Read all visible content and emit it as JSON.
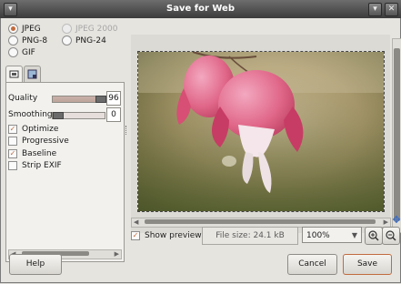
{
  "window": {
    "title": "Save for Web"
  },
  "format": {
    "options": [
      {
        "label": "JPEG",
        "selected": true,
        "disabled": false
      },
      {
        "label": "JPEG 2000",
        "selected": false,
        "disabled": true
      },
      {
        "label": "PNG-8",
        "selected": false,
        "disabled": false
      },
      {
        "label": "PNG-24",
        "selected": false,
        "disabled": false
      },
      {
        "label": "GIF",
        "selected": false,
        "disabled": false
      }
    ]
  },
  "settings": {
    "quality_label": "Quality",
    "quality_value": "96",
    "quality_level": 0.96,
    "smoothing_label": "Smoothing",
    "smoothing_value": "0",
    "smoothing_level": 0.0,
    "checks": [
      {
        "label": "Optimize",
        "checked": true
      },
      {
        "label": "Progressive",
        "checked": false
      },
      {
        "label": "Baseline",
        "checked": true
      },
      {
        "label": "Strip EXIF",
        "checked": false
      }
    ]
  },
  "preview": {
    "show_label": "Show preview",
    "show_checked": true,
    "file_size": "File size: 24.1 kB",
    "zoom": "100%"
  },
  "buttons": {
    "help": "Help",
    "cancel": "Cancel",
    "save": "Save"
  },
  "colors": {
    "accent": "#c16b3e"
  }
}
